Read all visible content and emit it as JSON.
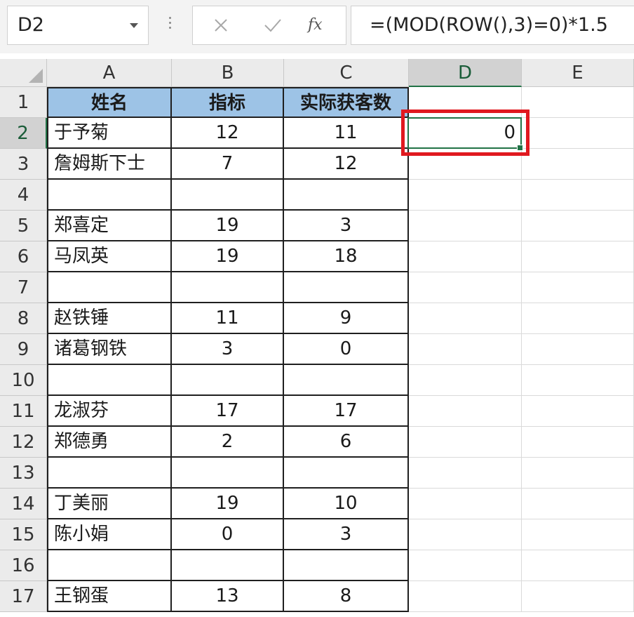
{
  "name_box": "D2",
  "formula": "=(MOD(ROW(),3)=0)*1.5",
  "formula_buttons": {
    "fx": "fx"
  },
  "columns": [
    "A",
    "B",
    "C",
    "D",
    "E"
  ],
  "selected_column": "D",
  "selected_row": "2",
  "header_row": {
    "row": "1",
    "a": "姓名",
    "b": "指标",
    "c": "实际获客数"
  },
  "rows": [
    {
      "row": "2",
      "a": "于予菊",
      "b": "12",
      "c": "11",
      "d": "0"
    },
    {
      "row": "3",
      "a": "詹姆斯下士",
      "b": "7",
      "c": "12",
      "d": ""
    },
    {
      "row": "4",
      "a": "",
      "b": "",
      "c": "",
      "d": ""
    },
    {
      "row": "5",
      "a": "郑喜定",
      "b": "19",
      "c": "3",
      "d": ""
    },
    {
      "row": "6",
      "a": "马凤英",
      "b": "19",
      "c": "18",
      "d": ""
    },
    {
      "row": "7",
      "a": "",
      "b": "",
      "c": "",
      "d": ""
    },
    {
      "row": "8",
      "a": "赵铁锤",
      "b": "11",
      "c": "9",
      "d": ""
    },
    {
      "row": "9",
      "a": "诸葛钢铁",
      "b": "3",
      "c": "0",
      "d": ""
    },
    {
      "row": "10",
      "a": "",
      "b": "",
      "c": "",
      "d": ""
    },
    {
      "row": "11",
      "a": "龙淑芬",
      "b": "17",
      "c": "17",
      "d": ""
    },
    {
      "row": "12",
      "a": "郑德勇",
      "b": "2",
      "c": "6",
      "d": ""
    },
    {
      "row": "13",
      "a": "",
      "b": "",
      "c": "",
      "d": ""
    },
    {
      "row": "14",
      "a": "丁美丽",
      "b": "19",
      "c": "10",
      "d": ""
    },
    {
      "row": "15",
      "a": "陈小娟",
      "b": "0",
      "c": "3",
      "d": ""
    },
    {
      "row": "16",
      "a": "",
      "b": "",
      "c": "",
      "d": ""
    },
    {
      "row": "17",
      "a": "王钢蛋",
      "b": "13",
      "c": "8",
      "d": ""
    }
  ],
  "colors": {
    "header_fill": "#9dc3e6",
    "selection": "#217346",
    "highlight": "#e0191f"
  }
}
